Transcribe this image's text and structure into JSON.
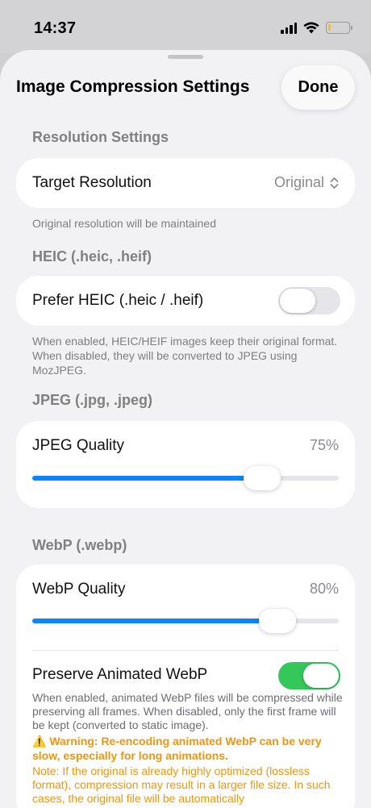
{
  "status_bar": {
    "time": "14:37",
    "battery_level": 0.15
  },
  "sheet": {
    "title": "Image Compression Settings",
    "done_label": "Done"
  },
  "resolution": {
    "header": "Resolution Settings",
    "label": "Target Resolution",
    "value": "Original",
    "footnote": "Original resolution will be maintained"
  },
  "heic": {
    "header": "HEIC (.heic, .heif)",
    "label": "Prefer HEIC (.heic / .heif)",
    "enabled": false,
    "footnote": "When enabled, HEIC/HEIF images keep their original format. When disabled, they will be converted to JPEG using MozJPEG."
  },
  "jpeg": {
    "header": "JPEG (.jpg, .jpeg)",
    "label": "JPEG Quality",
    "value_text": "75%",
    "quality": 75
  },
  "webp": {
    "header": "WebP (.webp)",
    "label": "WebP Quality",
    "value_text": "80%",
    "quality": 80,
    "animated_label": "Preserve Animated WebP",
    "animated_enabled": true,
    "animated_description": "When enabled, animated WebP files will be compressed while preserving all frames. When disabled, only the first frame will be kept (converted to static image).",
    "warning": "⚠️ Warning: Re-encoding animated WebP can be very slow, especially for long animations.",
    "note": "Note: If the original is already highly optimized (lossless format), compression may result in a larger file size. In such cases, the original file will be automatically"
  },
  "colors": {
    "accent": "#0a84ff",
    "toggle_on": "#34c759",
    "warning": "#f0950c"
  },
  "icons": {
    "picker": "chevron-up-down-icon",
    "signal": "cellular-signal-icon",
    "wifi": "wifi-icon",
    "battery": "battery-icon"
  }
}
